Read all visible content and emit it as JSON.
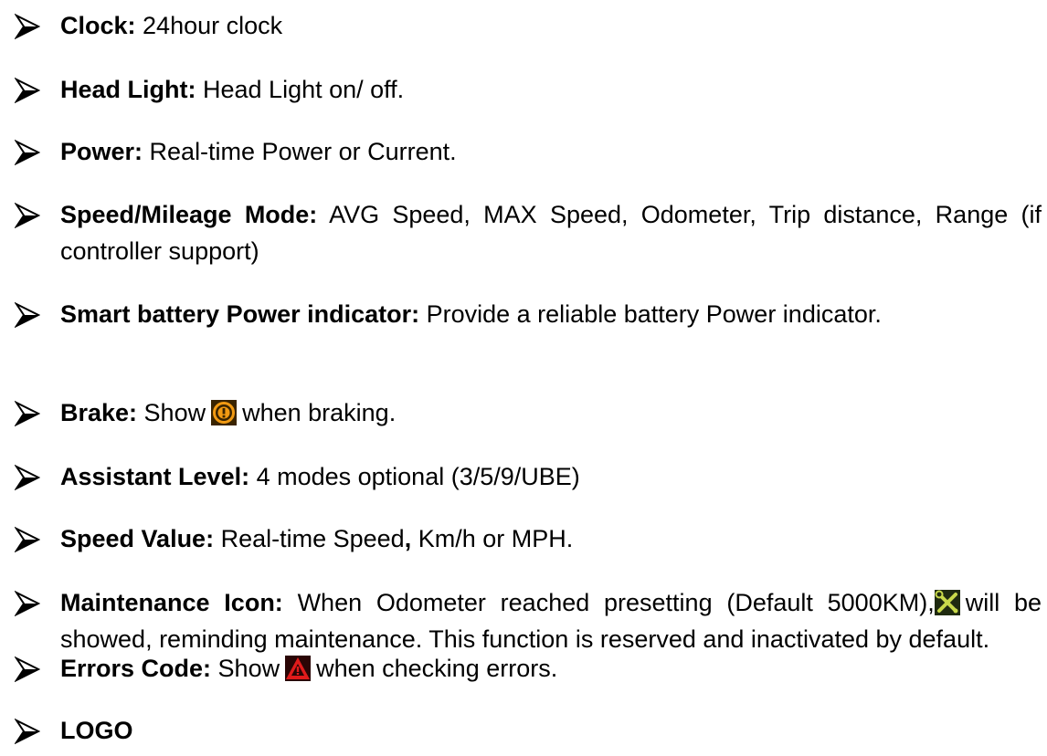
{
  "items": [
    {
      "title": "Clock:",
      "desc": " 24hour clock"
    },
    {
      "title": "Head Light:",
      "desc": " Head Light on/ off."
    },
    {
      "title": "Power:",
      "desc": " Real-time Power or Current."
    },
    {
      "title": "Speed/Mileage Mode:",
      "desc": " AVG Speed, MAX Speed, Odometer, Trip distance, Range (if controller support)"
    },
    {
      "title": "Smart battery Power indicator:",
      "desc": " Provide a reliable battery Power indicator."
    },
    {
      "title": "Brake:",
      "desc_before": " Show",
      "desc_after": "when braking."
    },
    {
      "title": "Assistant Level:",
      "desc": " 4 modes optional (3/5/9/UBE)"
    },
    {
      "title": "Speed Value:",
      "desc_a": " Real-time Speed",
      "desc_comma": ",",
      "desc_b": " Km/h or MPH."
    },
    {
      "title": "Maintenance Icon:",
      "desc_before": " When Odometer reached presetting (Default 5000KM),",
      "desc_after": "will be showed, reminding maintenance. This function is reserved and inactivated by default."
    },
    {
      "title": "Errors Code:",
      "desc_before": " Show",
      "desc_after": "when checking errors."
    },
    {
      "title": "LOGO"
    }
  ],
  "icons": {
    "brake": "brake-warning-icon",
    "maintenance": "maintenance-tools-icon",
    "error": "error-warning-triangle-icon"
  }
}
